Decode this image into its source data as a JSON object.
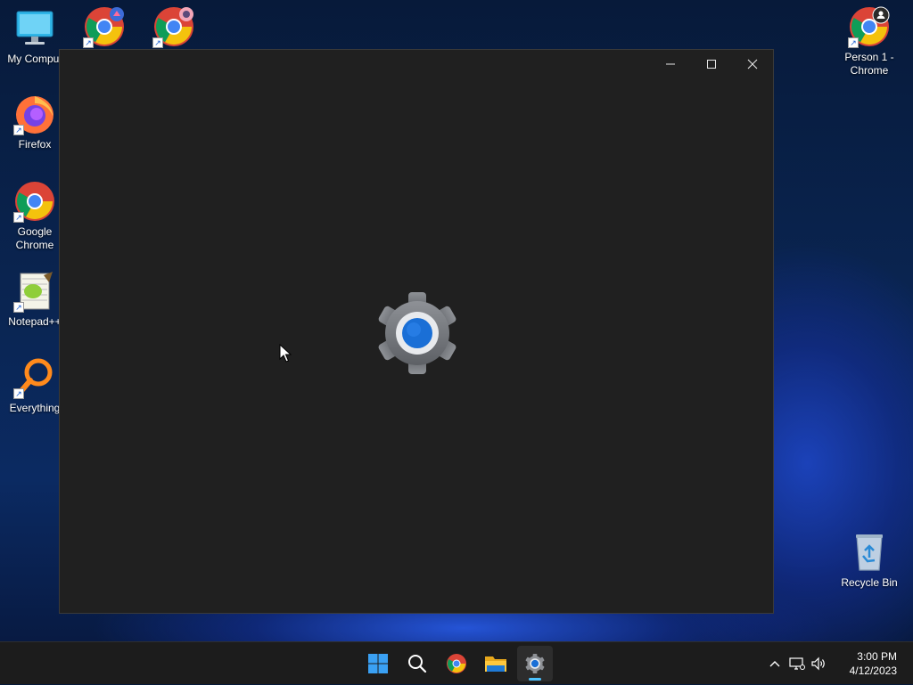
{
  "desktop": {
    "icons": [
      {
        "label": "My Comput",
        "icon": "computer-icon"
      },
      {
        "label": "",
        "icon": "chrome-profile-icon"
      },
      {
        "label": "",
        "icon": "chrome-profile-icon"
      },
      {
        "label": "Firefox",
        "icon": "firefox-icon"
      },
      {
        "label": "Google Chrome",
        "icon": "chrome-icon"
      },
      {
        "label": "Notepad++",
        "icon": "notepadpp-icon"
      },
      {
        "label": "Everything",
        "icon": "everything-icon"
      },
      {
        "label": "Person 1 - Chrome",
        "icon": "chrome-profile-icon"
      },
      {
        "label": "Recycle Bin",
        "icon": "recycle-bin-icon"
      }
    ]
  },
  "window": {
    "app": "Settings",
    "splash_icon": "gear-icon",
    "controls": {
      "minimize": "minimize-icon",
      "maximize": "maximize-icon",
      "close": "close-icon"
    }
  },
  "taskbar": {
    "buttons": [
      {
        "name": "start",
        "icon": "windows-logo-icon"
      },
      {
        "name": "search",
        "icon": "search-icon"
      },
      {
        "name": "chrome",
        "icon": "chrome-icon"
      },
      {
        "name": "file-explorer",
        "icon": "folder-icon"
      },
      {
        "name": "settings",
        "icon": "gear-icon",
        "active": true
      }
    ],
    "tray": {
      "chevron": "chevron-up-icon",
      "network": "network-icon",
      "volume": "volume-icon"
    },
    "clock": {
      "time": "3:00 PM",
      "date": "4/12/2023"
    }
  },
  "colors": {
    "window_bg": "#202020",
    "taskbar_bg": "#1c1c1c",
    "accent": "#4cc2ff",
    "gear_center": "#1a6fd6"
  }
}
